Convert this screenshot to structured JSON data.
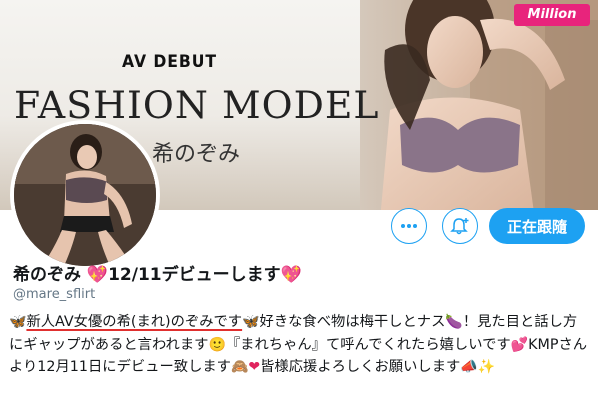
{
  "banner": {
    "kicker": "AV DEBUT",
    "headline": "FASHION MODEL",
    "name": "希のぞみ",
    "brand_logo": "Million"
  },
  "profile": {
    "display_name": "希のぞみ",
    "display_name_suffix": "12/11デビューします",
    "handle": "@mare_sflirt"
  },
  "actions": {
    "more_icon": "more-icon",
    "notify_icon": "bell-plus-icon",
    "follow_label": "正在跟隨",
    "accent_color": "#1da1f2"
  },
  "bio": {
    "part1_underlined": "新人AV女優の希(まれ)のぞみです",
    "part2": "好きな食べ物は梅干しとナス",
    "part3": "！見た目と話し方にギャップがあると言われます",
    "part4": "『まれちゃん』て呼んでくれたら嬉しいです",
    "part5": "KMPさんより12月11日にデビュー致します",
    "part6": "皆様応援よろしくお願いします",
    "emoji": {
      "butterfly": "🦋",
      "eggplant": "🍆",
      "smile": "🙂",
      "two_hearts": "💕",
      "see_no_evil": "🙈",
      "heart": "❤",
      "megaphone": "📣",
      "sparkles": "✨",
      "sparkling_heart": "💖"
    }
  }
}
